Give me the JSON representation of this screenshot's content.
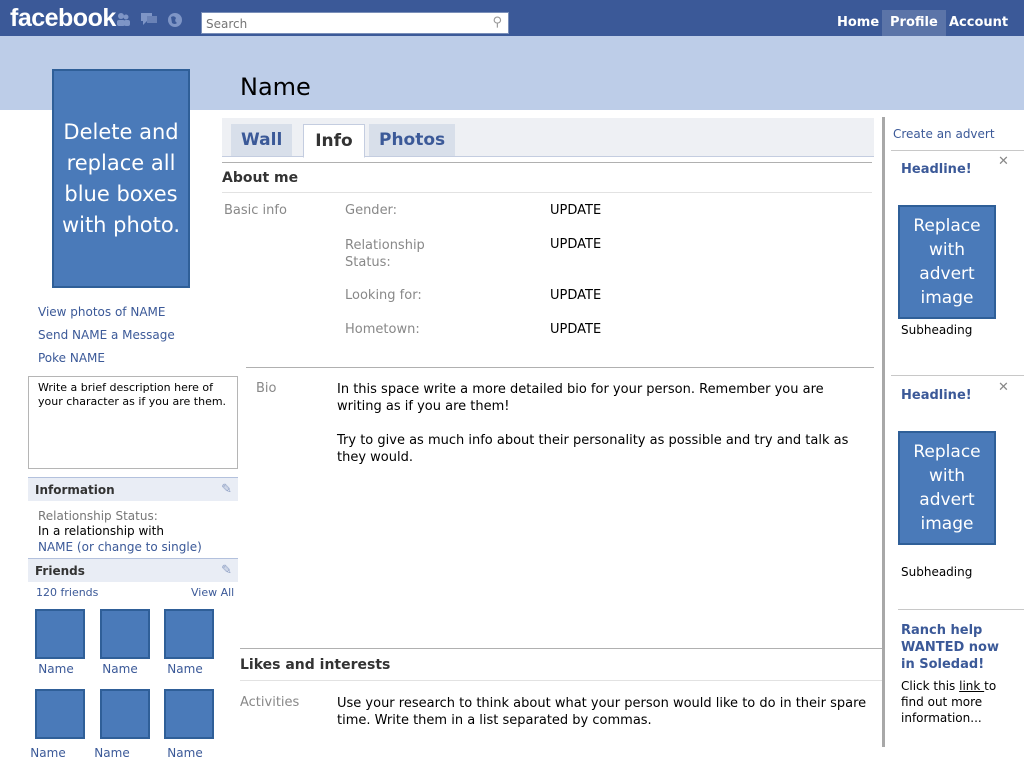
{
  "topbar": {
    "logo": "facebook",
    "search_placeholder": "Search",
    "nav": [
      "Home",
      "Profile",
      "Account ▾"
    ]
  },
  "profile": {
    "name": "Name",
    "photo_text": "Delete and replace all blue boxes with photo.",
    "links": [
      "View photos of NAME",
      "Send NAME a Message",
      "Poke NAME"
    ],
    "description": "Write a brief description here of your character as if you are them."
  },
  "information": {
    "title": "Information",
    "status_label": "Relationship Status:",
    "status_value": "In a relationship with",
    "status_link": "NAME (or change to single)"
  },
  "friends": {
    "title": "Friends",
    "count": "120 friends",
    "view_all": "View All",
    "names": [
      "Name",
      "Name",
      "Name",
      "Name",
      "Name",
      "Name"
    ]
  },
  "tabs": [
    "Wall",
    "Info",
    "Photos"
  ],
  "about": {
    "title": "About me",
    "basic_info_label": "Basic info",
    "rows": [
      {
        "label": "Gender:",
        "value": "UPDATE"
      },
      {
        "label": "Relationship Status:",
        "value": "UPDATE"
      },
      {
        "label": "Looking for:",
        "value": "UPDATE"
      },
      {
        "label": "Hometown:",
        "value": "UPDATE"
      }
    ],
    "bio_label": "Bio",
    "bio_p1": "In this space write a more detailed bio for your person. Remember you are writing as if you are them!",
    "bio_p2": "Try to give as much info about their personality as possible and try and talk as they would."
  },
  "likes": {
    "title": "Likes and interests",
    "activities_label": "Activities",
    "activities_text": "Use your research to think about what your person would like to do in their spare time. Write them in a list separated by commas."
  },
  "ads": {
    "create_link": "Create an advert",
    "items": [
      {
        "headline": "Headline!",
        "image_text": "Replace with advert image",
        "subheading": "Subheading"
      },
      {
        "headline": "Headline!",
        "image_text": "Replace with advert image",
        "subheading": "Subheading"
      }
    ],
    "promo": {
      "headline": "Ranch help WANTED now in Soledad!",
      "text_before": "Click this ",
      "link": "link ",
      "text_after": "to find out more information..."
    }
  }
}
